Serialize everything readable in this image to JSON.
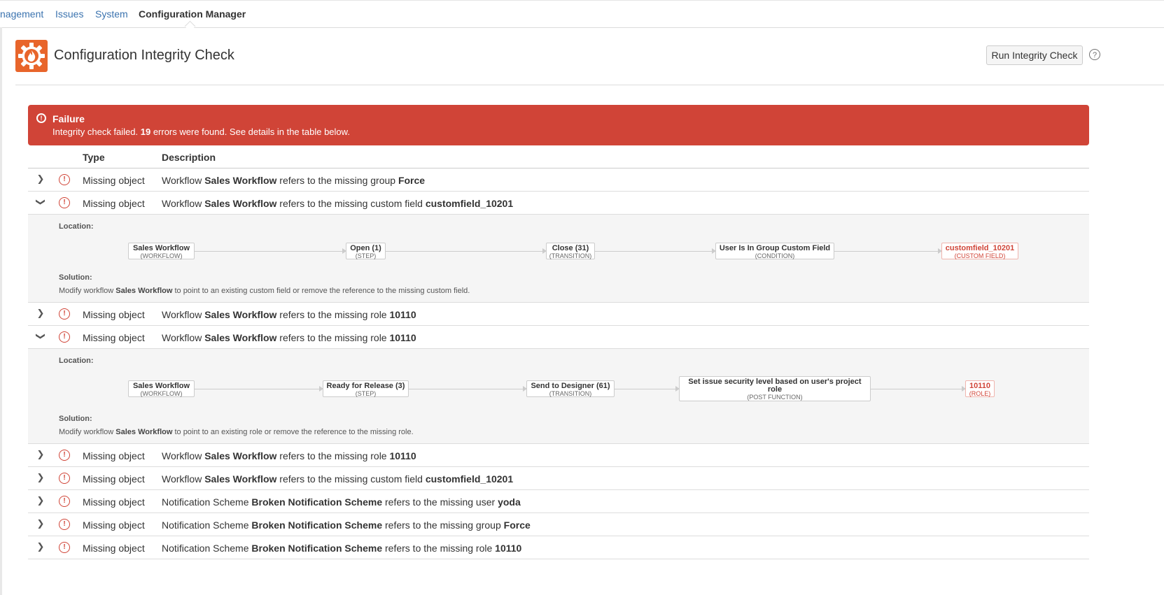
{
  "nav": {
    "tabs": [
      {
        "label": "nagement"
      },
      {
        "label": "Issues"
      },
      {
        "label": "System"
      },
      {
        "label": "Configuration Manager"
      }
    ]
  },
  "header": {
    "title": "Configuration Integrity Check",
    "run_button": "Run Integrity Check",
    "help_glyph": "?"
  },
  "banner": {
    "title": "Failure",
    "text_before": "Integrity check failed. ",
    "count": "19",
    "text_after": " errors were found. See details in the table below.",
    "color": "#d04437"
  },
  "table": {
    "headers": {
      "type": "Type",
      "description": "Description"
    },
    "rows": [
      {
        "type": "Missing object",
        "prefix": "Workflow ",
        "subject": "Sales Workflow",
        "middle": " refers to the missing group ",
        "target": "Force"
      },
      {
        "type": "Missing object",
        "prefix": "Workflow ",
        "subject": "Sales Workflow",
        "middle": " refers to the missing custom field ",
        "target": "customfield_10201"
      },
      {
        "type": "Missing object",
        "prefix": "Workflow ",
        "subject": "Sales Workflow",
        "middle": " refers to the missing role ",
        "target": "10110"
      },
      {
        "type": "Missing object",
        "prefix": "Workflow ",
        "subject": "Sales Workflow",
        "middle": " refers to the missing role ",
        "target": "10110"
      },
      {
        "type": "Missing object",
        "prefix": "Workflow ",
        "subject": "Sales Workflow",
        "middle": " refers to the missing role ",
        "target": "10110"
      },
      {
        "type": "Missing object",
        "prefix": "Workflow ",
        "subject": "Sales Workflow",
        "middle": " refers to the missing custom field ",
        "target": "customfield_10201"
      },
      {
        "type": "Missing object",
        "prefix": "Notification Scheme ",
        "subject": "Broken Notification Scheme",
        "middle": " refers to the missing user ",
        "target": "yoda"
      },
      {
        "type": "Missing object",
        "prefix": "Notification Scheme ",
        "subject": "Broken Notification Scheme",
        "middle": " refers to the missing group ",
        "target": "Force"
      },
      {
        "type": "Missing object",
        "prefix": "Notification Scheme ",
        "subject": "Broken Notification Scheme",
        "middle": " refers to the missing role ",
        "target": "10110"
      }
    ],
    "details": {
      "d1": {
        "location_label": "Location:",
        "solution_label": "Solution:",
        "nodes": [
          {
            "name": "Sales Workflow",
            "kind": "(WORKFLOW)"
          },
          {
            "name": "Open (1)",
            "kind": "(STEP)"
          },
          {
            "name": "Close (31)",
            "kind": "(TRANSITION)"
          },
          {
            "name": "User Is In Group Custom Field",
            "kind": "(CONDITION)"
          },
          {
            "name": "customfield_10201",
            "kind": "(CUSTOM FIELD)"
          }
        ],
        "solution_before": "Modify workflow ",
        "solution_subject": "Sales Workflow",
        "solution_after": " to point to an existing custom field or remove the reference to the missing custom field."
      },
      "d3": {
        "location_label": "Location:",
        "solution_label": "Solution:",
        "nodes": [
          {
            "name": "Sales Workflow",
            "kind": "(WORKFLOW)"
          },
          {
            "name": "Ready for Release (3)",
            "kind": "(STEP)"
          },
          {
            "name": "Send to Designer (61)",
            "kind": "(TRANSITION)"
          },
          {
            "name": "Set issue security level based on user's project role",
            "kind": "(POST FUNCTION)"
          },
          {
            "name": "10110",
            "kind": "(ROLE)"
          }
        ],
        "solution_before": "Modify workflow ",
        "solution_subject": "Sales Workflow",
        "solution_after": " to point to an existing role or remove the reference to the missing role."
      }
    }
  },
  "icons": {
    "collapsed": "chevron-right-icon",
    "expanded": "chevron-down-icon",
    "error": "error-circle-icon",
    "logo": "gear-flame-logo"
  },
  "colors": {
    "link": "#3b73af",
    "error": "#d04437",
    "logo": "#e8652b"
  }
}
